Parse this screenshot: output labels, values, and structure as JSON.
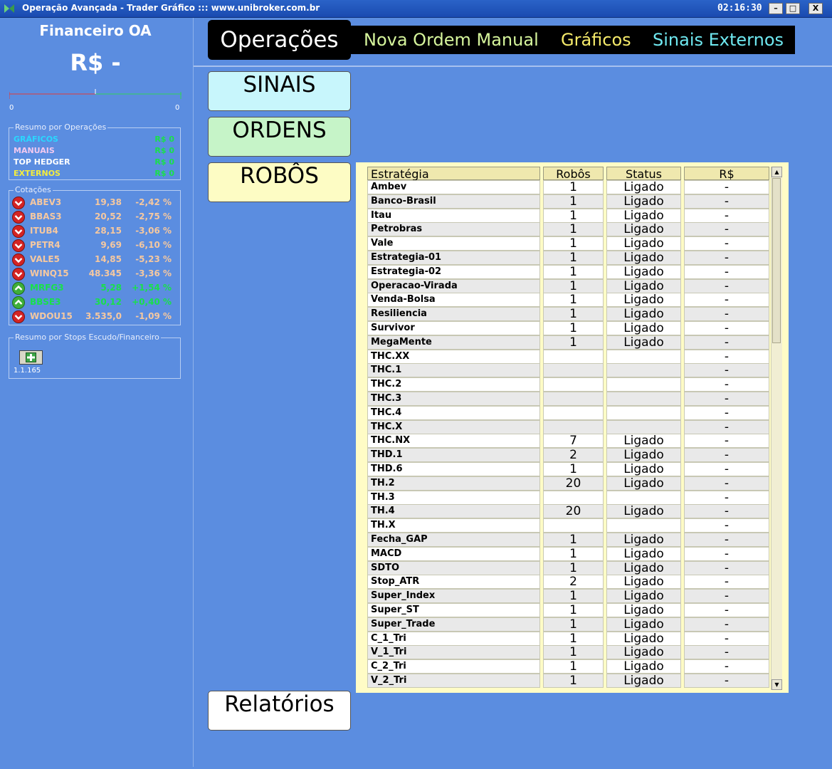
{
  "window": {
    "title": "Operação Avançada - Trader Gráfico ::: www.unibroker.com.br",
    "clock": "02:16:30",
    "buttons": {
      "minimize": "–",
      "maximize": "□",
      "close": "X"
    }
  },
  "left": {
    "financeiro_title": "Financeiro OA",
    "financeiro_value": "R$ -",
    "gauge_left": "0",
    "gauge_right": "0",
    "resumo_legend": "Resumo por Operações",
    "resumo": [
      {
        "label": "GRÁFICOS",
        "value": "R$ 0",
        "color": "#29d8ff"
      },
      {
        "label": "MANUAIS",
        "value": "R$ 0",
        "color": "#f2c9f0"
      },
      {
        "label": "TOP HEDGER",
        "value": "R$ 0",
        "color": "#ffffff"
      },
      {
        "label": "EXTERNOS",
        "value": "R$ 0",
        "color": "#f5ee3c"
      }
    ],
    "cotacoes_legend": "Cotações",
    "cotacoes": [
      {
        "symbol": "ABEV3",
        "price": "19,38",
        "change": "-2,42 %",
        "trend": "down"
      },
      {
        "symbol": "BBAS3",
        "price": "20,52",
        "change": "-2,75 %",
        "trend": "down"
      },
      {
        "symbol": "ITUB4",
        "price": "28,15",
        "change": "-3,06 %",
        "trend": "down"
      },
      {
        "symbol": "PETR4",
        "price": "9,69",
        "change": "-6,10 %",
        "trend": "down"
      },
      {
        "symbol": "VALE5",
        "price": "14,85",
        "change": "-5,23 %",
        "trend": "down"
      },
      {
        "symbol": "WINQ15",
        "price": "48.345",
        "change": "-3,36 %",
        "trend": "down"
      },
      {
        "symbol": "MRFG3",
        "price": "5,28",
        "change": "+1,54 %",
        "trend": "up"
      },
      {
        "symbol": "BBSE3",
        "price": "30,12",
        "change": "+0,40 %",
        "trend": "up"
      },
      {
        "symbol": "WDOU15",
        "price": "3.535,0",
        "change": "-1,09 %",
        "trend": "down"
      }
    ],
    "stops_legend": "Resumo por Stops Escudo/Financeiro",
    "version": "1.1.165"
  },
  "nav": {
    "operacoes": "Operações",
    "nova_ordem": "Nova Ordem Manual",
    "graficos": "Gráficos",
    "sinais_externos": "Sinais Externos",
    "colors": {
      "nova_ordem": "#d6f59c",
      "graficos": "#f5ea6a",
      "sinais_externos": "#6fe8f0"
    }
  },
  "side": {
    "sinais": "SINAIS",
    "ordens": "ORDENS",
    "robos": "ROBÔS",
    "relatorios": "Relatórios"
  },
  "table": {
    "headers": [
      "Estratégia",
      "Robôs",
      "Status",
      "R$"
    ],
    "rows": [
      [
        "Ambev",
        "1",
        "Ligado",
        "-"
      ],
      [
        "Banco-Brasil",
        "1",
        "Ligado",
        "-"
      ],
      [
        "Itau",
        "1",
        "Ligado",
        "-"
      ],
      [
        "Petrobras",
        "1",
        "Ligado",
        "-"
      ],
      [
        "Vale",
        "1",
        "Ligado",
        "-"
      ],
      [
        "Estrategia-01",
        "1",
        "Ligado",
        "-"
      ],
      [
        "Estrategia-02",
        "1",
        "Ligado",
        "-"
      ],
      [
        "Operacao-Virada",
        "1",
        "Ligado",
        "-"
      ],
      [
        "Venda-Bolsa",
        "1",
        "Ligado",
        "-"
      ],
      [
        "Resiliencia",
        "1",
        "Ligado",
        "-"
      ],
      [
        "Survivor",
        "1",
        "Ligado",
        "-"
      ],
      [
        "MegaMente",
        "1",
        "Ligado",
        "-"
      ],
      [
        "THC.XX",
        "",
        "",
        "-"
      ],
      [
        "THC.1",
        "",
        "",
        "-"
      ],
      [
        "THC.2",
        "",
        "",
        "-"
      ],
      [
        "THC.3",
        "",
        "",
        "-"
      ],
      [
        "THC.4",
        "",
        "",
        "-"
      ],
      [
        "THC.X",
        "",
        "",
        "-"
      ],
      [
        "THC.NX",
        "7",
        "Ligado",
        "-"
      ],
      [
        "THD.1",
        "2",
        "Ligado",
        "-"
      ],
      [
        "THD.6",
        "1",
        "Ligado",
        "-"
      ],
      [
        "TH.2",
        "20",
        "Ligado",
        "-"
      ],
      [
        "TH.3",
        "",
        "",
        "-"
      ],
      [
        "TH.4",
        "20",
        "Ligado",
        "-"
      ],
      [
        "TH.X",
        "",
        "",
        "-"
      ],
      [
        "Fecha_GAP",
        "1",
        "Ligado",
        "-"
      ],
      [
        "MACD",
        "1",
        "Ligado",
        "-"
      ],
      [
        "SDTO",
        "1",
        "Ligado",
        "-"
      ],
      [
        "Stop_ATR",
        "2",
        "Ligado",
        "-"
      ],
      [
        "Super_Index",
        "1",
        "Ligado",
        "-"
      ],
      [
        "Super_ST",
        "1",
        "Ligado",
        "-"
      ],
      [
        "Super_Trade",
        "1",
        "Ligado",
        "-"
      ],
      [
        "C_1_Tri",
        "1",
        "Ligado",
        "-"
      ],
      [
        "V_1_Tri",
        "1",
        "Ligado",
        "-"
      ],
      [
        "C_2_Tri",
        "1",
        "Ligado",
        "-"
      ],
      [
        "V_2_Tri",
        "1",
        "Ligado",
        "-"
      ]
    ]
  }
}
